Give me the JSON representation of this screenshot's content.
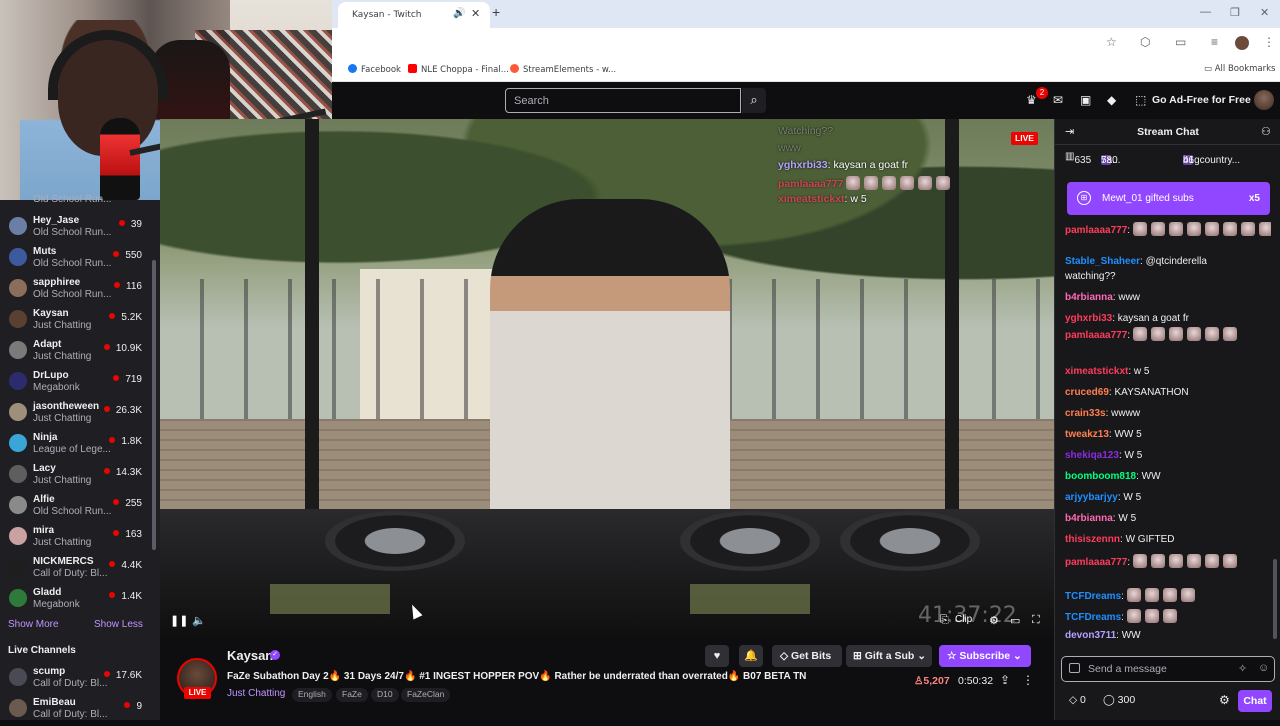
{
  "browser": {
    "tab_title": "Kaysan - Twitch",
    "bookmarks": [
      {
        "label": "Facebook",
        "color": "#1877f2"
      },
      {
        "label": "NLE Choppa - Final...",
        "color": "#ff0000"
      },
      {
        "label": "StreamElements - w...",
        "color": "#ff5a36"
      }
    ],
    "all_bookmarks": "All Bookmarks"
  },
  "twitch_nav": {
    "search_placeholder": "Search",
    "notification_count": "2",
    "ad_free": "Go Ad-Free for Free"
  },
  "sidebar": {
    "cut_top_game": "Old School Run...",
    "channels": [
      {
        "name": "Hey_Jase",
        "game": "Old School Run...",
        "viewers": "39",
        "color": "#6b7fa6"
      },
      {
        "name": "Muts",
        "game": "Old School Run...",
        "viewers": "550",
        "color": "#3d5a9e"
      },
      {
        "name": "sapphiree",
        "game": "Old School Run...",
        "viewers": "116",
        "color": "#8a6d5a"
      },
      {
        "name": "Kaysan",
        "game": "Just Chatting",
        "viewers": "5.2K",
        "color": "#5a4032"
      },
      {
        "name": "Adapt",
        "game": "Just Chatting",
        "viewers": "10.9K",
        "color": "#7a7a7a"
      },
      {
        "name": "DrLupo",
        "game": "Megabonk",
        "viewers": "719",
        "color": "#2b2b6e"
      },
      {
        "name": "jasontheween",
        "game": "Just Chatting",
        "viewers": "26.3K",
        "color": "#9e8f7a"
      },
      {
        "name": "Ninja",
        "game": "League of Lege...",
        "viewers": "1.8K",
        "color": "#3aa6d8"
      },
      {
        "name": "Lacy",
        "game": "Just Chatting",
        "viewers": "14.3K",
        "color": "#5e5e5e"
      },
      {
        "name": "Alfie",
        "game": "Old School Run...",
        "viewers": "255",
        "color": "#8a8a8a"
      },
      {
        "name": "mira",
        "game": "Just Chatting",
        "viewers": "163",
        "color": "#c9a1a1"
      },
      {
        "name": "NICKMERCS",
        "game": "Call of Duty: Bl...",
        "viewers": "4.4K",
        "color": "#1e1e1e"
      },
      {
        "name": "Gladd",
        "game": "Megabonk",
        "viewers": "1.4K",
        "color": "#2d7a3a"
      }
    ],
    "show_more": "Show More",
    "show_less": "Show Less",
    "live_channels_heading": "Live Channels",
    "live_channels": [
      {
        "name": "scump",
        "game": "Call of Duty: Bl...",
        "viewers": "17.6K",
        "color": "#4a4a55"
      },
      {
        "name": "EmiBeau",
        "game": "Call of Duty: Bl...",
        "viewers": "9",
        "color": "#6a5a50"
      }
    ]
  },
  "video": {
    "live_label": "LIVE",
    "overlay_chat": [
      {
        "user": "",
        "text": "Watching??"
      },
      {
        "user": "",
        "text": "www"
      },
      {
        "user": "yghxrbi33",
        "text": ": kaysan a goat fr"
      },
      {
        "user": "pamlaaaa777",
        "text": ""
      },
      {
        "user": "ximeatstickxt",
        "text": ": w 5"
      }
    ],
    "clip_label": "Clip",
    "watermark_timer": "41:37:22"
  },
  "stream": {
    "streamer": "Kaysan",
    "live_label": "LIVE",
    "title": "FaZe Subathon Day 2🔥 31 Days 24/7🔥 #1 INGEST HOPPER POV🔥 Rather be underrated than overrated🔥 B07 BETA TN",
    "category": "Just Chatting",
    "tags": [
      "English",
      "FaZe",
      "D10",
      "FaZeClan"
    ],
    "get_bits": "Get Bits",
    "gift_sub": "Gift a Sub",
    "subscribe": "Subscribe",
    "viewers": "5,207",
    "uptime": "0:50:32"
  },
  "chat": {
    "title": "Stream Chat",
    "leaderboard": [
      {
        "rank": "",
        "value": "635"
      },
      {
        "rank": "7a...",
        "value": "580"
      },
      {
        "rank": "b1gcountry...",
        "value": "46"
      }
    ],
    "gift_banner": {
      "user": "Mewt_01",
      "text": "gifted subs",
      "count": "x5"
    },
    "messages": [
      {
        "user": "pamlaaaa777",
        "color": "#ff3c5a",
        "text": ":",
        "emotes": 8
      },
      {
        "user": "Stable_Shaheer",
        "color": "#1e90ff",
        "text": ": @qtcinderella"
      },
      {
        "user": "",
        "color": "#efeff1",
        "text": "watching??"
      },
      {
        "user": "b4rbianna",
        "color": "#ff69b4",
        "text": ": www"
      },
      {
        "user": "yghxrbi33",
        "color": "#ff3c5a",
        "text": ": kaysan a goat fr"
      },
      {
        "user": "pamlaaaa777",
        "color": "#ff3c5a",
        "text": ":",
        "emotes": 6
      },
      {
        "user": "ximeatstickxt",
        "color": "#ff3c5a",
        "text": ": w 5"
      },
      {
        "user": "cruced69",
        "color": "#ff7f50",
        "text": ": KAYSANATHON"
      },
      {
        "user": "crain33s",
        "color": "#ff7f50",
        "text": ": wwww"
      },
      {
        "user": "tweakz13",
        "color": "#ff7f50",
        "text": ": WW 5"
      },
      {
        "user": "shekiqa123",
        "color": "#8a2be2",
        "text": ": W 5"
      },
      {
        "user": "boomboom818",
        "color": "#00ff7f",
        "text": ": WW"
      },
      {
        "user": "arjyybarjyy",
        "color": "#1e90ff",
        "text": ": W 5"
      },
      {
        "user": "b4rbianna",
        "color": "#ff69b4",
        "text": ": W 5"
      },
      {
        "user": "thisiszennn",
        "color": "#ff3c5a",
        "text": ": W GIFTED"
      },
      {
        "user": "pamlaaaa777",
        "color": "#ff3c5a",
        "text": ":",
        "emotes": 6
      },
      {
        "user": "TCFDreams",
        "color": "#1e90ff",
        "text": ":",
        "emotes": 4
      },
      {
        "user": "TCFDreams",
        "color": "#1e90ff",
        "text": ":",
        "emotes": 3
      },
      {
        "user": "devon3711",
        "color": "#b7a2ff",
        "text": ": WW"
      }
    ],
    "input_placeholder": "Send a message",
    "points": "0",
    "bits_count": "300",
    "send_label": "Chat"
  }
}
